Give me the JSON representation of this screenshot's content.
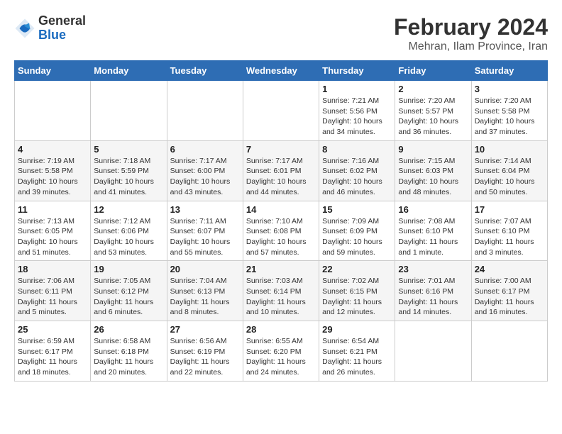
{
  "logo": {
    "general": "General",
    "blue": "Blue"
  },
  "title": "February 2024",
  "subtitle": "Mehran, Ilam Province, Iran",
  "days_of_week": [
    "Sunday",
    "Monday",
    "Tuesday",
    "Wednesday",
    "Thursday",
    "Friday",
    "Saturday"
  ],
  "weeks": [
    [
      {
        "day": "",
        "info": ""
      },
      {
        "day": "",
        "info": ""
      },
      {
        "day": "",
        "info": ""
      },
      {
        "day": "",
        "info": ""
      },
      {
        "day": "1",
        "info": "Sunrise: 7:21 AM\nSunset: 5:56 PM\nDaylight: 10 hours\nand 34 minutes."
      },
      {
        "day": "2",
        "info": "Sunrise: 7:20 AM\nSunset: 5:57 PM\nDaylight: 10 hours\nand 36 minutes."
      },
      {
        "day": "3",
        "info": "Sunrise: 7:20 AM\nSunset: 5:58 PM\nDaylight: 10 hours\nand 37 minutes."
      }
    ],
    [
      {
        "day": "4",
        "info": "Sunrise: 7:19 AM\nSunset: 5:58 PM\nDaylight: 10 hours\nand 39 minutes."
      },
      {
        "day": "5",
        "info": "Sunrise: 7:18 AM\nSunset: 5:59 PM\nDaylight: 10 hours\nand 41 minutes."
      },
      {
        "day": "6",
        "info": "Sunrise: 7:17 AM\nSunset: 6:00 PM\nDaylight: 10 hours\nand 43 minutes."
      },
      {
        "day": "7",
        "info": "Sunrise: 7:17 AM\nSunset: 6:01 PM\nDaylight: 10 hours\nand 44 minutes."
      },
      {
        "day": "8",
        "info": "Sunrise: 7:16 AM\nSunset: 6:02 PM\nDaylight: 10 hours\nand 46 minutes."
      },
      {
        "day": "9",
        "info": "Sunrise: 7:15 AM\nSunset: 6:03 PM\nDaylight: 10 hours\nand 48 minutes."
      },
      {
        "day": "10",
        "info": "Sunrise: 7:14 AM\nSunset: 6:04 PM\nDaylight: 10 hours\nand 50 minutes."
      }
    ],
    [
      {
        "day": "11",
        "info": "Sunrise: 7:13 AM\nSunset: 6:05 PM\nDaylight: 10 hours\nand 51 minutes."
      },
      {
        "day": "12",
        "info": "Sunrise: 7:12 AM\nSunset: 6:06 PM\nDaylight: 10 hours\nand 53 minutes."
      },
      {
        "day": "13",
        "info": "Sunrise: 7:11 AM\nSunset: 6:07 PM\nDaylight: 10 hours\nand 55 minutes."
      },
      {
        "day": "14",
        "info": "Sunrise: 7:10 AM\nSunset: 6:08 PM\nDaylight: 10 hours\nand 57 minutes."
      },
      {
        "day": "15",
        "info": "Sunrise: 7:09 AM\nSunset: 6:09 PM\nDaylight: 10 hours\nand 59 minutes."
      },
      {
        "day": "16",
        "info": "Sunrise: 7:08 AM\nSunset: 6:10 PM\nDaylight: 11 hours\nand 1 minute."
      },
      {
        "day": "17",
        "info": "Sunrise: 7:07 AM\nSunset: 6:10 PM\nDaylight: 11 hours\nand 3 minutes."
      }
    ],
    [
      {
        "day": "18",
        "info": "Sunrise: 7:06 AM\nSunset: 6:11 PM\nDaylight: 11 hours\nand 5 minutes."
      },
      {
        "day": "19",
        "info": "Sunrise: 7:05 AM\nSunset: 6:12 PM\nDaylight: 11 hours\nand 6 minutes."
      },
      {
        "day": "20",
        "info": "Sunrise: 7:04 AM\nSunset: 6:13 PM\nDaylight: 11 hours\nand 8 minutes."
      },
      {
        "day": "21",
        "info": "Sunrise: 7:03 AM\nSunset: 6:14 PM\nDaylight: 11 hours\nand 10 minutes."
      },
      {
        "day": "22",
        "info": "Sunrise: 7:02 AM\nSunset: 6:15 PM\nDaylight: 11 hours\nand 12 minutes."
      },
      {
        "day": "23",
        "info": "Sunrise: 7:01 AM\nSunset: 6:16 PM\nDaylight: 11 hours\nand 14 minutes."
      },
      {
        "day": "24",
        "info": "Sunrise: 7:00 AM\nSunset: 6:17 PM\nDaylight: 11 hours\nand 16 minutes."
      }
    ],
    [
      {
        "day": "25",
        "info": "Sunrise: 6:59 AM\nSunset: 6:17 PM\nDaylight: 11 hours\nand 18 minutes."
      },
      {
        "day": "26",
        "info": "Sunrise: 6:58 AM\nSunset: 6:18 PM\nDaylight: 11 hours\nand 20 minutes."
      },
      {
        "day": "27",
        "info": "Sunrise: 6:56 AM\nSunset: 6:19 PM\nDaylight: 11 hours\nand 22 minutes."
      },
      {
        "day": "28",
        "info": "Sunrise: 6:55 AM\nSunset: 6:20 PM\nDaylight: 11 hours\nand 24 minutes."
      },
      {
        "day": "29",
        "info": "Sunrise: 6:54 AM\nSunset: 6:21 PM\nDaylight: 11 hours\nand 26 minutes."
      },
      {
        "day": "",
        "info": ""
      },
      {
        "day": "",
        "info": ""
      }
    ]
  ]
}
